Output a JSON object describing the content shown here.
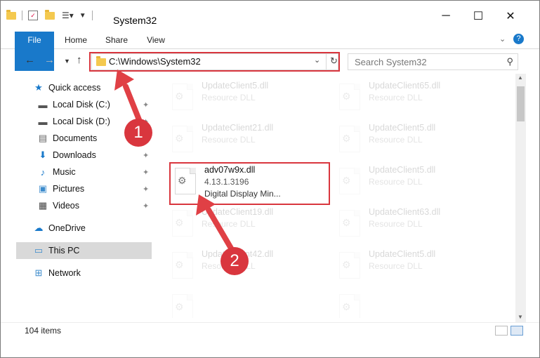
{
  "window": {
    "title": "System32"
  },
  "ribbon": {
    "tabs": [
      "File",
      "Home",
      "Share",
      "View"
    ]
  },
  "address": {
    "path": "C:\\Windows\\System32"
  },
  "search": {
    "placeholder": "Search System32"
  },
  "sidebar": {
    "items": [
      {
        "label": "Quick access"
      },
      {
        "label": "Local Disk (C:)"
      },
      {
        "label": "Local Disk (D:)"
      },
      {
        "label": "Documents"
      },
      {
        "label": "Downloads"
      },
      {
        "label": "Music"
      },
      {
        "label": "Pictures"
      },
      {
        "label": "Videos"
      },
      {
        "label": "OneDrive"
      },
      {
        "label": "This PC"
      },
      {
        "label": "Network"
      }
    ]
  },
  "files": [
    {
      "name": "UpdateClient5.dll",
      "desc": "Resource DLL"
    },
    {
      "name": "UpdateClient65.dll",
      "desc": "Resource DLL"
    },
    {
      "name": "UpdateClient21.dll",
      "desc": "Resource DLL"
    },
    {
      "name": "UpdateClient5.dll",
      "desc": "Resource DLL"
    },
    {
      "name": "adv07w9x.dll",
      "desc": "4.13.1.3196",
      "desc2": "Digital Display Min..."
    },
    {
      "name": "UpdateClient5.dll",
      "desc": "Resource DLL"
    },
    {
      "name": "UpdateClient19.dll",
      "desc": "Resource DLL"
    },
    {
      "name": "UpdateClient63.dll",
      "desc": "Resource DLL"
    },
    {
      "name": "UpdateClient42.dll",
      "desc": "Resource DLL"
    },
    {
      "name": "UpdateClient5.dll",
      "desc": "Resource DLL"
    }
  ],
  "status": {
    "count": "104 items"
  },
  "badges": {
    "one": "1",
    "two": "2"
  },
  "colors": {
    "accent": "#1979ca",
    "highlight": "#d9363e"
  }
}
